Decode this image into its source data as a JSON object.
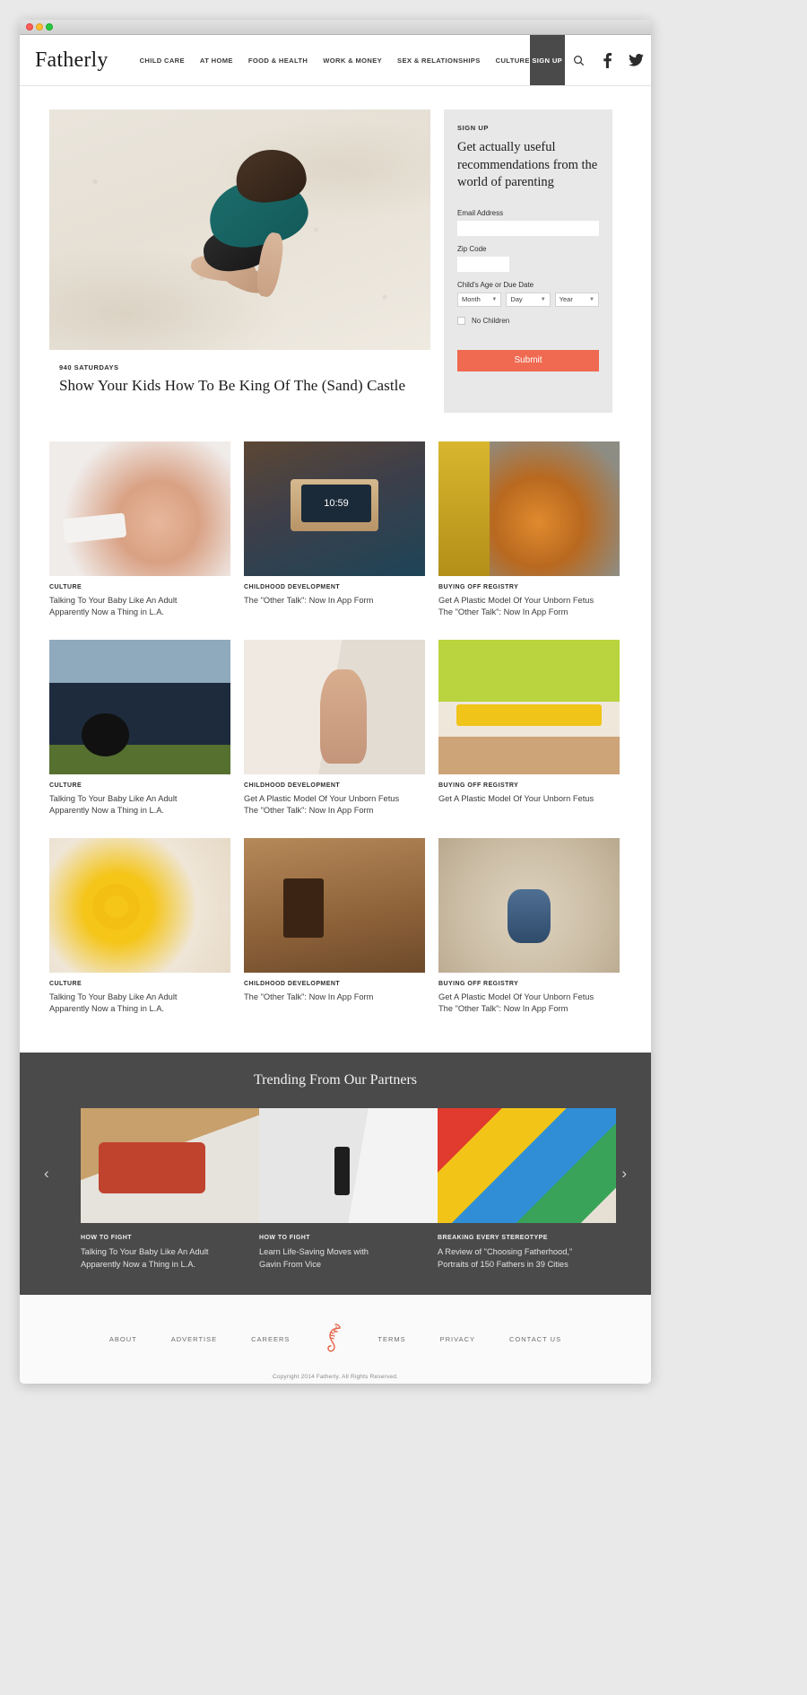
{
  "window": {
    "traffic_lights": [
      "close",
      "minimize",
      "zoom"
    ]
  },
  "header": {
    "logo": "Fatherly",
    "nav": [
      {
        "label": "CHILD CARE"
      },
      {
        "label": "AT HOME"
      },
      {
        "label": "FOOD & HEALTH"
      },
      {
        "label": "WORK & MONEY"
      },
      {
        "label": "SEX & RELATIONSHIPS"
      },
      {
        "label": "CULTURE"
      }
    ],
    "signup_label": "SIGN UP",
    "icons": [
      "search-icon",
      "facebook-icon",
      "twitter-icon"
    ]
  },
  "hero": {
    "kicker": "940 SATURDAYS",
    "title": "Show Your Kids How To Be King Of The (Sand) Castle"
  },
  "signup": {
    "kicker": "SIGN UP",
    "headline": "Get actually useful recommendations from the world of parenting",
    "email_label": "Email Address",
    "email_value": "",
    "zip_label": "Zip Code",
    "zip_value": "",
    "dob_label": "Child's Age or Due Date",
    "month": "Month",
    "day": "Day",
    "year": "Year",
    "no_children_label": "No Children",
    "no_children_checked": false,
    "submit_label": "Submit",
    "accent_color": "#ef6a50",
    "panel_color": "#e8e8e8"
  },
  "grid": {
    "rows": [
      {
        "cards": [
          {
            "kicker": "CULTURE",
            "line1": "Talking To Your Baby Like An Adult",
            "line2": "Apparently Now a Thing in L.A.",
            "photo": "p-baby",
            "alt": "newborn-baby-photo"
          },
          {
            "kicker": "CHILDHOOD DEVELOPMENT",
            "line1": "The \"Other Talk\": Now In App Form",
            "line2": "",
            "photo": "p-clock",
            "alt": "bedside-clock-photo",
            "clock_time": "10:59"
          },
          {
            "kicker": "BUYING OFF REGISTRY",
            "line1": "Get A Plastic Model Of Your Unborn Fetus",
            "line2": "The \"Other Talk\": Now In App Form",
            "photo": "p-carrots",
            "alt": "carrots-bowl-photo"
          }
        ]
      },
      {
        "cards": [
          {
            "kicker": "CULTURE",
            "line1": "Talking To Your Baby Like An Adult",
            "line2": "Apparently Now a Thing in L.A.",
            "photo": "p-car",
            "alt": "station-wagon-photo"
          },
          {
            "kicker": "CHILDHOOD DEVELOPMENT",
            "line1": "Get A Plastic Model Of Your Unborn Fetus",
            "line2": "The \"Other Talk\": Now In App Form",
            "photo": "p-kidwall",
            "alt": "toddler-by-wall-photo"
          },
          {
            "kicker": "BUYING OFF REGISTRY",
            "line1": "Get A Plastic Model Of Your Unborn Fetus",
            "line2": "",
            "photo": "p-class",
            "alt": "classroom-photo"
          }
        ]
      },
      {
        "cards": [
          {
            "kicker": "CULTURE",
            "line1": "Talking To Your Baby Like An Adult",
            "line2": "Apparently Now a Thing in L.A.",
            "photo": "p-ring",
            "alt": "baby-rattle-photo"
          },
          {
            "kicker": "CHILDHOOD DEVELOPMENT",
            "line1": "The \"Other Talk\": Now In App Form",
            "line2": "",
            "photo": "p-coffee",
            "alt": "espresso-glasses-photo"
          },
          {
            "kicker": "BUYING OFF REGISTRY",
            "line1": "Get A Plastic Model Of Your Unborn Fetus",
            "line2": "The \"Other Talk\": Now In App Form",
            "photo": "p-sandbox",
            "alt": "baby-in-sandbox-photo"
          }
        ]
      }
    ]
  },
  "trending": {
    "title": "Trending From Our Partners",
    "prev": "‹",
    "next": "›",
    "cards": [
      {
        "kicker": "HOW TO FIGHT",
        "line1": "Talking To Your Baby Like An Adult",
        "line2": "Apparently Now a Thing in L.A.",
        "photo": "t-sandwich",
        "alt": "sandwich-photo"
      },
      {
        "kicker": "HOW TO FIGHT",
        "line1": "Learn Life-Saving Moves with",
        "line2": "Gavin From Vice",
        "photo": "t-coats",
        "alt": "coat-hooks-photo"
      },
      {
        "kicker": "BREAKING EVERY STEREOTYPE",
        "line1": "A Review of \"Choosing Fatherhood,\"",
        "line2": "Portraits of 150 Fathers in 39 Cities",
        "photo": "t-blocks",
        "alt": "colored-blocks-photo"
      }
    ],
    "bg_color": "#4a4a4a"
  },
  "footer": {
    "links_left": [
      {
        "label": "ABOUT"
      },
      {
        "label": "ADVERTISE"
      },
      {
        "label": "CAREERS"
      }
    ],
    "links_right": [
      {
        "label": "TERMS"
      },
      {
        "label": "PRIVACY"
      },
      {
        "label": "CONTACT US"
      }
    ],
    "logo_icon": "seahorse-icon",
    "logo_color": "#e8634a",
    "copyright": "Copyright 2014 Fatherly. All Rights Reserved."
  }
}
